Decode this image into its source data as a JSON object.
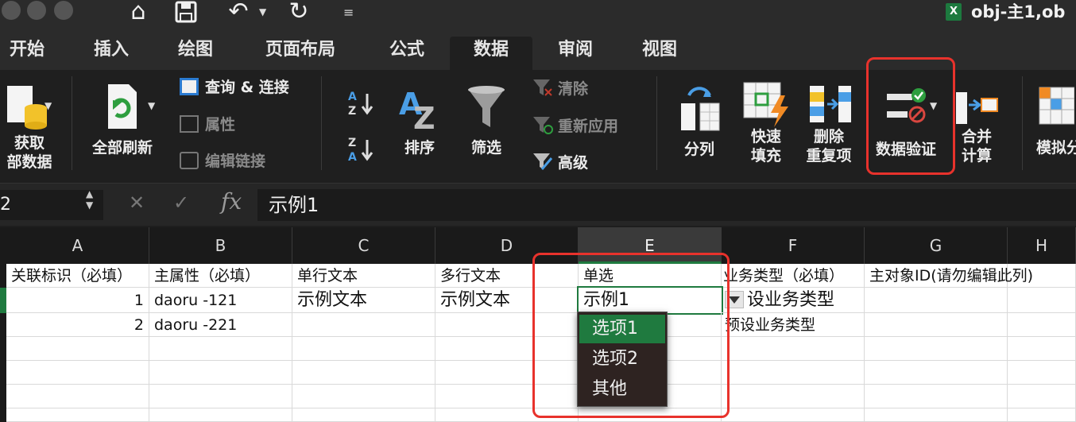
{
  "window": {
    "title": "obj-主1,ob"
  },
  "tabs": [
    {
      "label": "开始"
    },
    {
      "label": "插入"
    },
    {
      "label": "绘图"
    },
    {
      "label": "页面布局"
    },
    {
      "label": "公式"
    },
    {
      "label": "数据"
    },
    {
      "label": "审阅"
    },
    {
      "label": "视图"
    }
  ],
  "ribbon": {
    "get_data": [
      "获取",
      "部数据"
    ],
    "refresh_all": "全部刷新",
    "queries": "查询 & 连接",
    "properties": "属性",
    "edit_links": "编辑链接",
    "sort": "排序",
    "filter": "筛选",
    "clear": "清除",
    "reapply": "重新应用",
    "advanced": "高级",
    "text_to_columns": "分列",
    "flash_fill": [
      "快速",
      "填充"
    ],
    "remove_duplicates": [
      "删除",
      "重复项"
    ],
    "data_validation": "数据验证",
    "consolidate": [
      "合并",
      "计算"
    ],
    "what_if": "模拟分"
  },
  "formula_bar": {
    "name_box": "2",
    "fx": "fx",
    "value": "示例1"
  },
  "columns": [
    "A",
    "B",
    "C",
    "D",
    "E",
    "F",
    "G",
    "H"
  ],
  "rows": [
    [
      "关联标识（必填）",
      "主属性（必填）",
      "单行文本",
      "多行文本",
      "单选",
      "业务类型（必填）",
      "主对象ID(请勿编辑此列)",
      ""
    ],
    [
      "1",
      "daoru -121",
      "示例文本",
      "示例文本",
      "示例1",
      "设业务类型",
      "",
      ""
    ],
    [
      "2",
      "daoru -221",
      "",
      "",
      "",
      "预设业务类型",
      "",
      ""
    ]
  ],
  "dropdown": {
    "options": [
      "选项1",
      "选项2",
      "其他"
    ],
    "selected_index": 0
  },
  "colors": {
    "accent": "#1f7a3f",
    "highlight": "#e8322c"
  }
}
